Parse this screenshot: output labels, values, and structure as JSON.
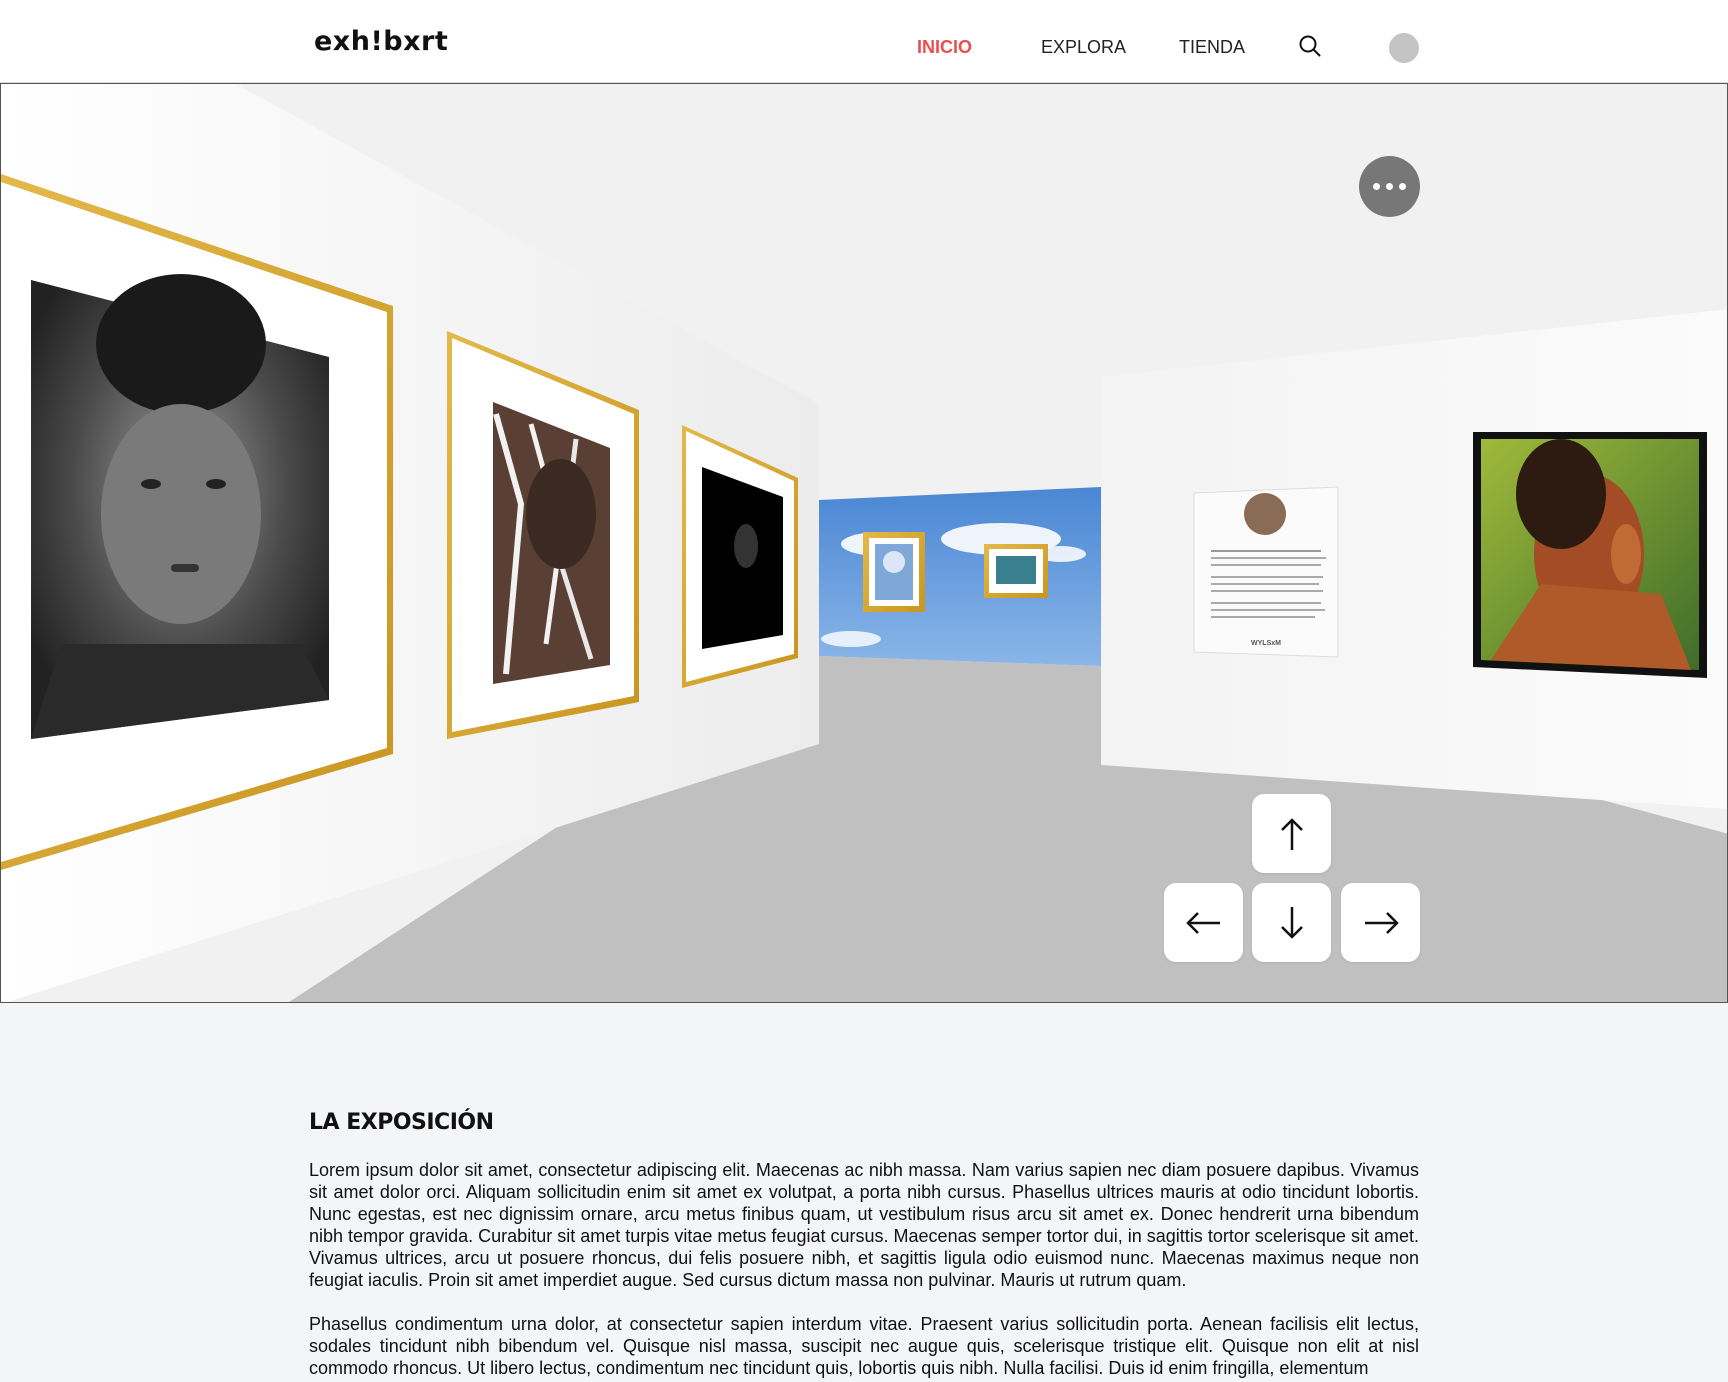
{
  "header": {
    "logo": "exh!bxrt",
    "nav": [
      {
        "label": "INICIO",
        "active": true
      },
      {
        "label": "EXPLORA",
        "active": false
      },
      {
        "label": "TIENDA",
        "active": false
      }
    ],
    "search_icon": "search-icon",
    "avatar_icon": "user-avatar"
  },
  "viewer": {
    "more_icon": "more-horizontal-icon",
    "controls": {
      "up": "arrow-up-icon",
      "left": "arrow-left-icon",
      "down": "arrow-down-icon",
      "right": "arrow-right-icon"
    },
    "placard_signature": "WYLSxM",
    "colors": {
      "frame_gold": "#d8a935",
      "wall": "#f2f2f2",
      "floor": "#c0c0c0",
      "sky": "#5b95d8"
    }
  },
  "exposicion": {
    "title": "LA EXPOSICIÓN",
    "paragraphs": [
      "Lorem ipsum dolor sit amet, consectetur adipiscing elit. Maecenas ac nibh massa. Nam varius sapien nec diam posuere dapibus. Vivamus sit amet dolor orci. Aliquam sollicitudin enim sit amet ex volutpat, a porta nibh cursus. Phasellus ultrices mauris at odio tincidunt lobortis. Nunc egestas, est nec dignissim ornare, arcu metus finibus quam, ut vestibulum risus arcu sit amet ex. Donec hendrerit urna bibendum nibh tempor gravida. Curabitur sit amet turpis vitae metus feugiat cursus. Maecenas semper tortor dui, in sagittis tortor scelerisque sit amet. Vivamus ultrices, arcu ut posuere rhoncus, dui felis posuere nibh, et sagittis ligula odio euismod nunc. Maecenas maximus neque non feugiat iaculis. Proin sit amet imperdiet augue. Sed cursus dictum massa non pulvinar. Mauris ut rutrum quam.",
      "Phasellus condimentum urna dolor, at consectetur sapien interdum vitae. Praesent varius sollicitudin porta. Aenean facilisis elit lectus, sodales tincidunt nibh bibendum vel. Quisque nisl massa, suscipit nec augue quis, scelerisque tristique elit. Quisque non elit at nisl commodo rhoncus. Ut libero lectus, condimentum nec tincidunt quis, lobortis quis nibh. Nulla facilisi. Duis id enim fringilla, elementum"
    ]
  }
}
